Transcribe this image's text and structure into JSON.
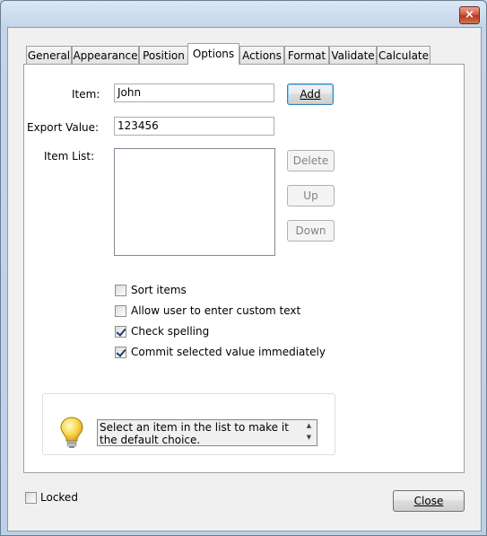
{
  "window": {
    "close_glyph": "×"
  },
  "tabs": [
    {
      "label": "General"
    },
    {
      "label": "Appearance"
    },
    {
      "label": "Position"
    },
    {
      "label": "Options",
      "active": true
    },
    {
      "label": "Actions"
    },
    {
      "label": "Format"
    },
    {
      "label": "Validate"
    },
    {
      "label": "Calculate"
    }
  ],
  "options": {
    "item_label": "Item:",
    "item_value": "John",
    "add_label": "Add",
    "export_label": "Export Value:",
    "export_value": "123456",
    "item_list_label": "Item List:",
    "delete_label": "Delete",
    "up_label": "Up",
    "down_label": "Down",
    "item_list": []
  },
  "checkboxes": [
    {
      "label": "Sort items",
      "checked": false
    },
    {
      "label": "Allow user to enter custom text",
      "checked": false
    },
    {
      "label": "Check spelling",
      "checked": true
    },
    {
      "label": "Commit selected value immediately",
      "checked": true
    }
  ],
  "tip": {
    "icon": "lightbulb-icon",
    "text": "Select an item in the list to make it the default choice."
  },
  "footer": {
    "locked_label": "Locked",
    "locked_checked": false,
    "close_label": "Close"
  }
}
